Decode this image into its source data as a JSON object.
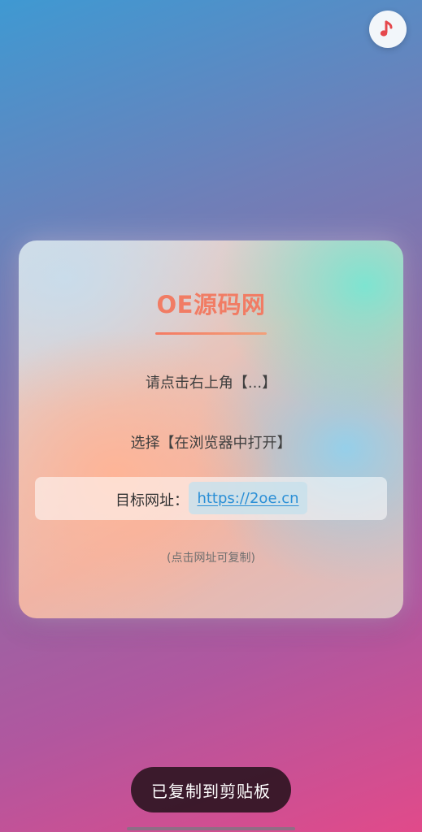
{
  "top_bar": {
    "music_icon": "music-note-icon",
    "accent_color": "#e5484d"
  },
  "card": {
    "title": "OE源码网",
    "instruction_1": "请点击右上角【...】",
    "instruction_2": "选择【在浏览器中打开】",
    "url_label": "目标网址：",
    "url": "https://2oe.cn",
    "hint": "(点击网址可复制)",
    "title_color": "#f17c64",
    "link_color": "#2b8fd6"
  },
  "toast": {
    "message": "已复制到剪贴板"
  }
}
